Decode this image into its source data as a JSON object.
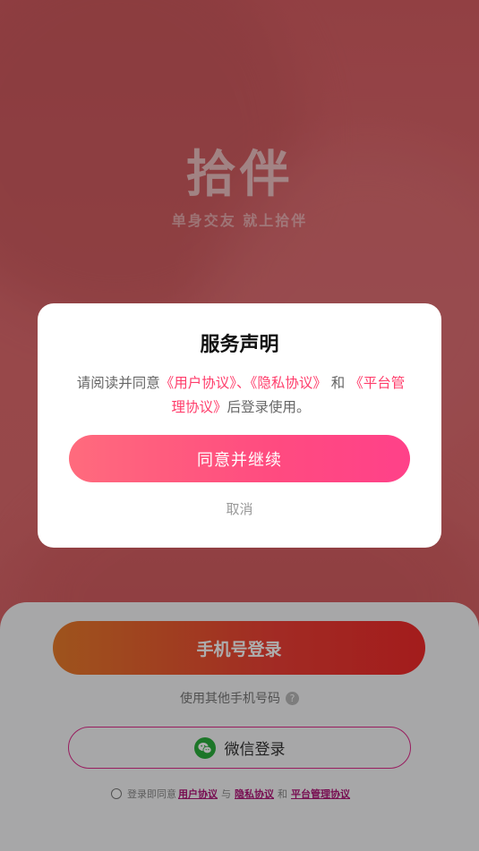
{
  "brand": {
    "title": "拾伴",
    "subtitle": "单身交友 就上拾伴"
  },
  "dialog": {
    "title": "服务声明",
    "body_prefix": "请阅读并同意",
    "user_agreement": "《用户协议》",
    "separator": "、",
    "privacy_agreement": "《隐私协议》",
    "and_text": "和",
    "platform_agreement": "《平台管理协议》",
    "body_suffix": "后登录使用。",
    "agree_button": "同意并继续",
    "cancel_button": "取消"
  },
  "login": {
    "phone_login_button": "手机号登录",
    "other_phone_text": "使用其他手机号码",
    "help_icon_glyph": "?",
    "wechat_login_button": "微信登录"
  },
  "agreement_bar": {
    "prefix": "登录即同意",
    "user_agreement": "用户协议",
    "with_text": "与",
    "privacy_agreement": "隐私协议",
    "and_text": "和",
    "platform_agreement": "平台管理协议"
  },
  "colors": {
    "primary_pink": "#ff4b80",
    "link_magenta": "#b2167a",
    "wechat_green": "#2aae3b",
    "login_orange": "#e97c2b",
    "login_red": "#f02a2a"
  },
  "icons": {
    "wechat": "wechat-icon",
    "help": "help-icon"
  }
}
